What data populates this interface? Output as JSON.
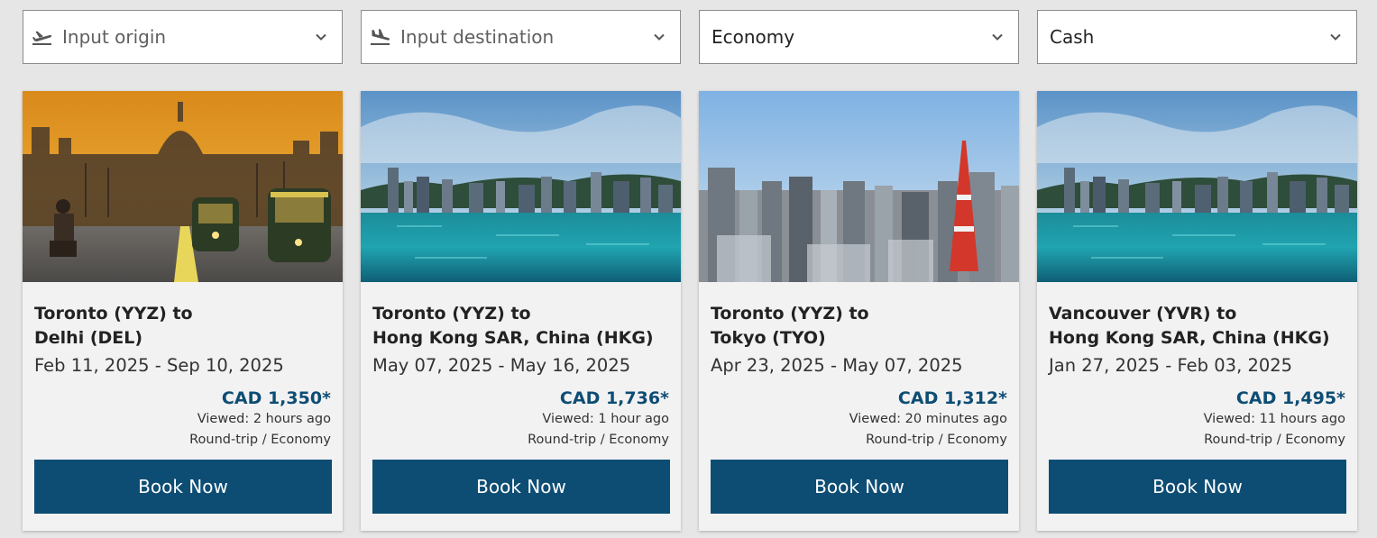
{
  "filters": {
    "origin": {
      "placeholder": "Input origin",
      "icon": "plane-takeoff-icon"
    },
    "destination": {
      "placeholder": "Input destination",
      "icon": "plane-landing-icon"
    },
    "cabin": {
      "value": "Economy"
    },
    "payment": {
      "value": "Cash"
    }
  },
  "colors": {
    "accent": "#0d4d74",
    "page_bg": "#e6e6e6",
    "card_bg": "#f2f2f2"
  },
  "cards": [
    {
      "route_line1": "Toronto (YYZ) to",
      "route_line2": "Delhi (DEL)",
      "dates": "Feb 11, 2025 - Sep 10, 2025",
      "price": "CAD 1,350*",
      "viewed": "Viewed: 2 hours ago",
      "trip": "Round-trip / Economy",
      "button": "Book Now",
      "image": "delhi-photo"
    },
    {
      "route_line1": "Toronto (YYZ) to",
      "route_line2": "Hong Kong SAR, China (HKG)",
      "dates": "May 07, 2025 - May 16, 2025",
      "price": "CAD 1,736*",
      "viewed": "Viewed: 1 hour ago",
      "trip": "Round-trip / Economy",
      "button": "Book Now",
      "image": "hong-kong-photo"
    },
    {
      "route_line1": "Toronto (YYZ) to",
      "route_line2": "Tokyo (TYO)",
      "dates": "Apr 23, 2025 - May 07, 2025",
      "price": "CAD 1,312*",
      "viewed": "Viewed: 20 minutes ago",
      "trip": "Round-trip / Economy",
      "button": "Book Now",
      "image": "tokyo-photo"
    },
    {
      "route_line1": "Vancouver (YVR) to",
      "route_line2": "Hong Kong SAR, China (HKG)",
      "dates": "Jan 27, 2025 - Feb 03, 2025",
      "price": "CAD 1,495*",
      "viewed": "Viewed: 11 hours ago",
      "trip": "Round-trip / Economy",
      "button": "Book Now",
      "image": "hong-kong-photo"
    }
  ]
}
